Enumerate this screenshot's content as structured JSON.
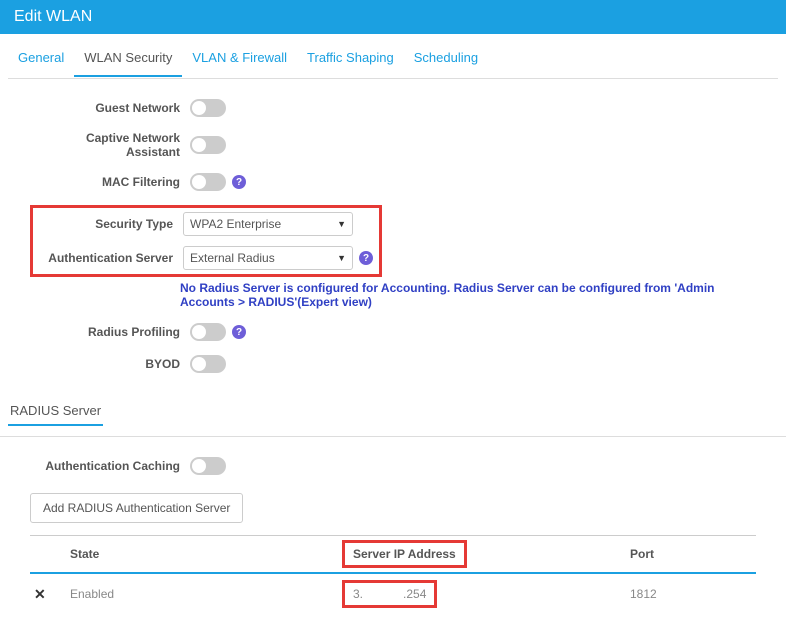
{
  "header": {
    "title": "Edit WLAN"
  },
  "tabs": [
    {
      "label": "General"
    },
    {
      "label": "WLAN Security"
    },
    {
      "label": "VLAN & Firewall"
    },
    {
      "label": "Traffic Shaping"
    },
    {
      "label": "Scheduling"
    }
  ],
  "form": {
    "guest_network": "Guest Network",
    "captive_assistant": "Captive Network Assistant",
    "mac_filtering": "MAC Filtering",
    "security_type_label": "Security Type",
    "security_type_value": "WPA2 Enterprise",
    "auth_server_label": "Authentication Server",
    "auth_server_value": "External Radius",
    "radius_profiling": "Radius Profiling",
    "byod": "BYOD"
  },
  "warning": "No Radius Server is configured for Accounting. Radius Server can be configured from 'Admin Accounts > RADIUS'(Expert view)",
  "subtab": "RADIUS Server",
  "section": {
    "auth_caching": "Authentication Caching",
    "add_button": "Add RADIUS Authentication Server"
  },
  "table": {
    "headers": {
      "state": "State",
      "ip": "Server IP Address",
      "port": "Port"
    },
    "row": {
      "state": "Enabled",
      "ip_pre": "3.",
      "ip_post": ".254",
      "port": "1812"
    }
  }
}
